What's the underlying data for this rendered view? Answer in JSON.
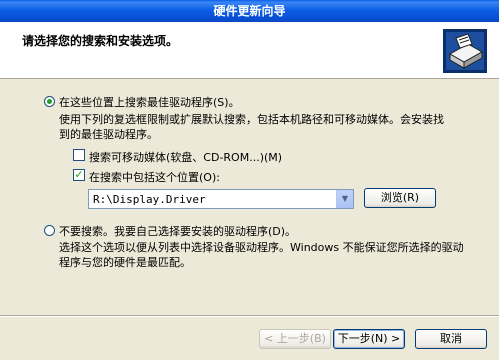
{
  "window": {
    "title": "硬件更新向导"
  },
  "header": {
    "title": "请选择您的搜索和安装选项。",
    "icon": "hardware-wizard-icon"
  },
  "options": {
    "search": {
      "label": "在这些位置上搜索最佳驱动程序(S)。",
      "desc_line1": "使用下列的复选框限制或扩展默认搜索，包括本机路径和可移动媒体。会安装找",
      "desc_line2": "到的最佳驱动程序。",
      "selected": true
    },
    "removable": {
      "label": "搜索可移动媒体(软盘、CD-ROM...)(M)",
      "checked": false
    },
    "include_location": {
      "label": "在搜索中包括这个位置(O):",
      "checked": true
    },
    "location_value": "R:\\Display.Driver",
    "browse_label": "浏览(R)",
    "dont_search": {
      "label": "不要搜索。我要自己选择要安装的驱动程序(D)。",
      "desc_line1": "选择这个选项以便从列表中选择设备驱动程序。Windows 不能保证您所选择的驱动",
      "desc_line2": "程序与您的硬件是最匹配。",
      "selected": false
    }
  },
  "footer": {
    "back_label": "< 上一步(B)",
    "next_label": "下一步(N) >",
    "cancel_label": "取消"
  }
}
